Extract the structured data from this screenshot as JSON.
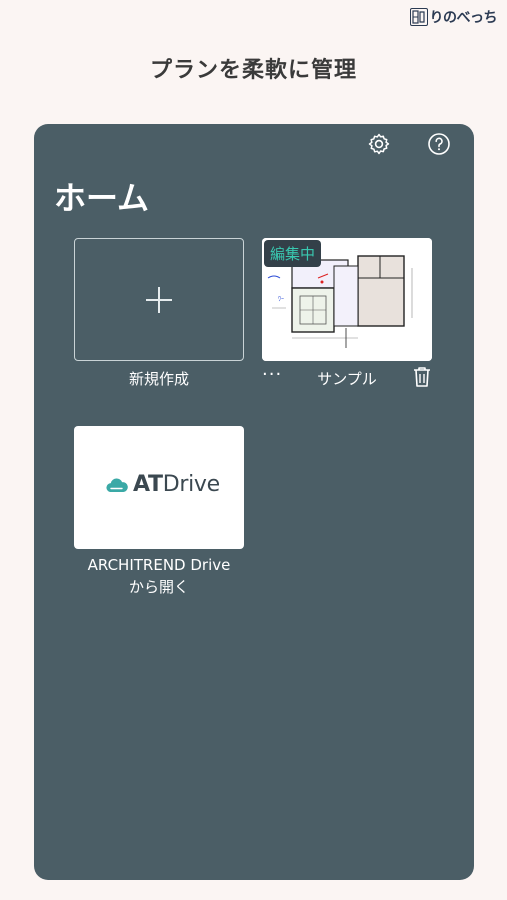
{
  "brand": {
    "mark": "明   ",
    "text": "りのべっち"
  },
  "headline": "プランを柔軟に管理",
  "panel": {
    "title": "ホーム",
    "settings_icon": "gear-icon",
    "help_icon": "question-circle-icon",
    "new_tile": {
      "label": "新規作成",
      "icon": "plus-icon"
    },
    "sample_tile": {
      "label": "サンプル",
      "badge": "編集中",
      "more_label": "···",
      "delete_icon": "trash-icon"
    },
    "drive_tile": {
      "logo_at": "AT",
      "logo_drive": "Drive",
      "label_line1": "ARCHITREND Drive",
      "label_line2": "から開く"
    }
  },
  "colors": {
    "panel": "#4b5e66",
    "background": "#fbf5f3",
    "badge_text": "#39c8b0",
    "drive_cloud": "#3aa9a6"
  }
}
